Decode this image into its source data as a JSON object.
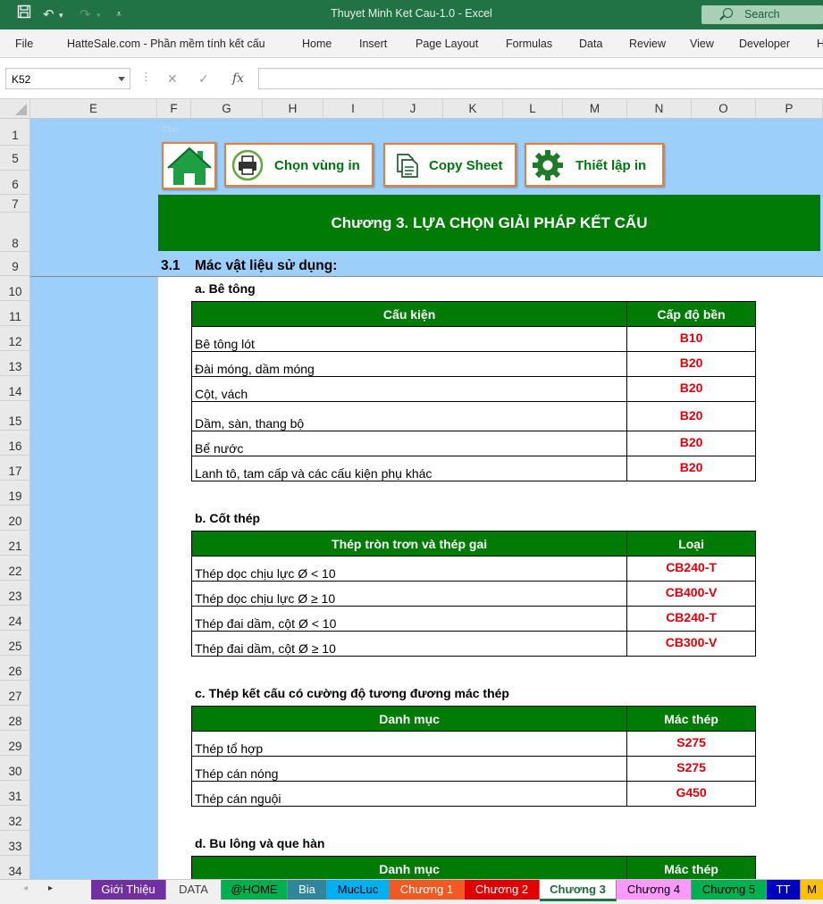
{
  "window": {
    "title": "Thuyet Minh Ket Cau-1.0  -  Excel",
    "search_label": "Search"
  },
  "ribbon": {
    "tabs": [
      "File",
      "HatteSale.com - Phần mềm tính kết cấu",
      "Home",
      "Insert",
      "Page Layout",
      "Formulas",
      "Data",
      "Review",
      "View",
      "Developer",
      "H"
    ]
  },
  "formula_bar": {
    "name_box": "K52",
    "formula": ""
  },
  "columns": [
    "E",
    "F",
    "G",
    "H",
    "I",
    "J",
    "K",
    "L",
    "M",
    "N",
    "O",
    "P"
  ],
  "rows": [
    "1",
    "5",
    "6",
    "7",
    "8",
    "9",
    "10",
    "11",
    "12",
    "13",
    "14",
    "15",
    "16",
    "17",
    "19",
    "20",
    "21",
    "22",
    "23",
    "24",
    "25",
    "26",
    "27",
    "28",
    "29",
    "30",
    "31",
    "32",
    "33",
    "34"
  ],
  "faint_cell_text": "Chủ",
  "buttons": {
    "home": "Trang chủ",
    "print_area": "Chọn vùng in",
    "copy_sheet": "Copy Sheet",
    "print_setup": "Thiết lập in"
  },
  "chapter_title": "Chương 3. LỰA CHỌN GIẢI PHÁP KẾT CẤU",
  "section": {
    "number": "3.1",
    "title": "Mác vật liệu sử dụng:"
  },
  "concrete": {
    "heading": "a. Bê tông",
    "headers": [
      "Cấu kiện",
      "Cấp độ bền"
    ],
    "rows": [
      [
        "Bê tông lót",
        "B10"
      ],
      [
        "Đài móng, dầm móng",
        "B20"
      ],
      [
        "Cột, vách",
        "B20"
      ],
      [
        "Dầm, sàn, thang bộ",
        "B20"
      ],
      [
        "Bể nước",
        "B20"
      ],
      [
        "Lanh tô, tam cấp và các cấu kiện phụ khác",
        "B20"
      ]
    ]
  },
  "rebar": {
    "heading": "b. Cốt thép",
    "headers": [
      "Thép tròn trơn và thép gai",
      "Loại"
    ],
    "rows": [
      [
        "Thép dọc chịu lực Ø < 10",
        "CB240-T"
      ],
      [
        "Thép dọc chịu lực Ø ≥ 10",
        "CB400-V"
      ],
      [
        "Thép đai dầm, cột Ø < 10",
        "CB240-T"
      ],
      [
        "Thép đai dầm, cột Ø ≥ 10",
        "CB300-V"
      ]
    ]
  },
  "structural_steel": {
    "heading": "c. Thép kết cấu có cường độ tương đương mác thép",
    "headers": [
      "Danh mục",
      "Mác thép"
    ],
    "rows": [
      [
        "Thép tổ hợp",
        "S275"
      ],
      [
        "Thép cán nóng",
        "S275"
      ],
      [
        "Thép cán nguội",
        "G450"
      ]
    ]
  },
  "bolts": {
    "heading": "d. Bu lông và que hàn",
    "headers": [
      "Danh mục",
      "Mác thép"
    ]
  },
  "sheet_tabs": [
    {
      "label": "Giới Thiệu",
      "bg": "#7030a0",
      "fg": "#ffffff"
    },
    {
      "label": "DATA",
      "bg": "#f0f0f0",
      "fg": "#404040"
    },
    {
      "label": "@HOME",
      "bg": "#00b050",
      "fg": "#000000"
    },
    {
      "label": "Bia",
      "bg": "#31869b",
      "fg": "#ffffff"
    },
    {
      "label": "MucLuc",
      "bg": "#00b0f0",
      "fg": "#000000"
    },
    {
      "label": "Chương 1",
      "bg": "#f05a22",
      "fg": "#ffffff"
    },
    {
      "label": "Chương 2",
      "bg": "#e00000",
      "fg": "#ffffff"
    },
    {
      "label": "Chương 3",
      "bg": "#ffffff",
      "fg": "#1e6b3a",
      "active": true
    },
    {
      "label": "Chương 4",
      "bg": "#ff99ff",
      "fg": "#000000"
    },
    {
      "label": "Chương 5",
      "bg": "#00b050",
      "fg": "#000000"
    },
    {
      "label": "TT",
      "bg": "#0000c0",
      "fg": "#ffffff"
    },
    {
      "label": "M",
      "bg": "#ffc000",
      "fg": "#000000"
    }
  ],
  "colors": {
    "accent_green": "#217346",
    "banner_green": "#007b05",
    "value_red": "#e0000a",
    "button_border": "#ed7d31",
    "blue_fill": "#9dcffb"
  }
}
